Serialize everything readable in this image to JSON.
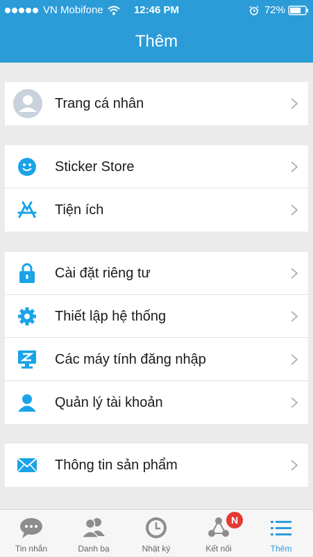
{
  "status_bar": {
    "carrier": "VN Mobifone",
    "time": "12:46 PM",
    "battery": "72%",
    "battery_level": 0.72
  },
  "header": {
    "title": "Thêm"
  },
  "sections": [
    {
      "items": [
        {
          "label": "Trang cá nhân",
          "icon": "avatar-icon"
        }
      ]
    },
    {
      "items": [
        {
          "label": "Sticker Store",
          "icon": "smiley-icon"
        },
        {
          "label": "Tiện ích",
          "icon": "app-store-icon"
        }
      ]
    },
    {
      "items": [
        {
          "label": "Cài đặt riêng tư",
          "icon": "lock-icon"
        },
        {
          "label": "Thiết lập hệ thống",
          "icon": "gear-icon"
        },
        {
          "label": "Các máy tính đăng nhập",
          "icon": "computer-icon"
        },
        {
          "label": "Quản lý tài khoản",
          "icon": "user-icon"
        }
      ]
    },
    {
      "items": [
        {
          "label": "Thông tin sản phẩm",
          "icon": "mail-icon"
        }
      ]
    }
  ],
  "tabbar": {
    "tabs": [
      {
        "label": "Tin nhắn",
        "icon": "chat-icon"
      },
      {
        "label": "Danh bạ",
        "icon": "contacts-icon"
      },
      {
        "label": "Nhật ký",
        "icon": "clock-icon"
      },
      {
        "label": "Kết nối",
        "icon": "connect-icon",
        "badge": "N"
      },
      {
        "label": "Thêm",
        "icon": "menu-icon",
        "active": true
      }
    ]
  },
  "colors": {
    "accent": "#2b9cd8",
    "icon_blue": "#1aa3e8",
    "badge": "#e53935",
    "background": "#ebebeb"
  }
}
